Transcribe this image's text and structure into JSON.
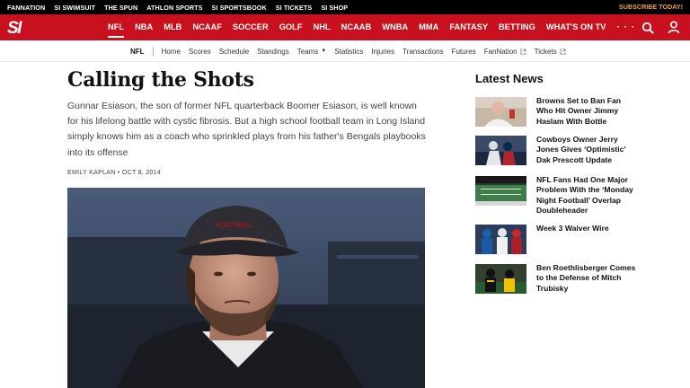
{
  "topbar": {
    "links": [
      "FANNATION",
      "SI SWIMSUIT",
      "THE SPUN",
      "ATHLON SPORTS",
      "SI SPORTSBOOK",
      "SI TICKETS",
      "SI SHOP"
    ],
    "subscribe": "SUBSCRIBE TODAY!"
  },
  "mainnav": {
    "logo": "SI",
    "items": [
      "NFL",
      "NBA",
      "MLB",
      "NCAAF",
      "SOCCER",
      "GOLF",
      "NHL",
      "NCAAB",
      "WNBA",
      "MMA",
      "FANTASY",
      "BETTING",
      "WHAT'S ON TV"
    ],
    "more": "· · ·",
    "active": "NFL"
  },
  "subnav": {
    "section": "NFL",
    "items": [
      "Home",
      "Scores",
      "Schedule",
      "Standings",
      "Teams",
      "Statistics",
      "Injuries",
      "Transactions",
      "Futures",
      "FanNation",
      "Tickets"
    ]
  },
  "article": {
    "title": "Calling the Shots",
    "dek": "Gunnar Esiason, the son of former NFL quarterback Boomer Esiason, is well known for his lifelong battle with cystic fibrosis. But a high school football team in Long Island simply knows him as a coach who sprinkled plays from his father's Bengals playbooks into its offense",
    "byline": "EMILY KAPLAN • OCT 8, 2014",
    "hero_cap_text": "FOOTBALL"
  },
  "latest": {
    "title": "Latest News",
    "items": [
      {
        "headline": "Browns Set to Ban Fan Who Hit Owner Jimmy Haslam With Bottle"
      },
      {
        "headline": "Cowboys Owner Jerry Jones Gives ‘Optimistic’ Dak Prescott Update"
      },
      {
        "headline": "NFL Fans Had One Major Problem With the ‘Monday Night Football’ Overlap Doubleheader"
      },
      {
        "headline": "Week 3 Waiver Wire"
      },
      {
        "headline": "Ben Roethlisberger Comes to the Defense of Mitch Trubisky"
      }
    ]
  },
  "colors": {
    "brand_red": "#c8101e",
    "subscribe": "#e8a33b"
  }
}
